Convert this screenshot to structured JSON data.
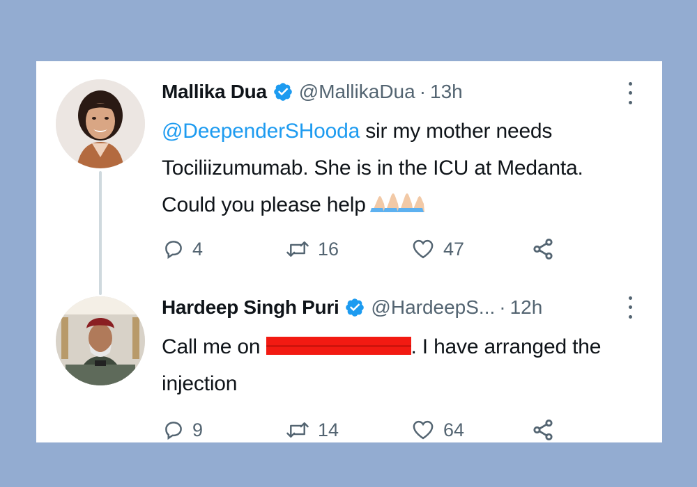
{
  "tweets": [
    {
      "name": "Mallika Dua",
      "handle": "@MallikaDua",
      "separator": "·",
      "time": "13h",
      "mention": "@DeependerSHooda",
      "line1_rest": " sir my mother needs",
      "line2": "Tociliizumumab. She is in the ICU at Medanta.",
      "line3": "Could you please help",
      "emoji": "folded-hands-emoji",
      "replies": "4",
      "retweets": "16",
      "likes": "47"
    },
    {
      "name": "Hardeep Singh Puri",
      "handle": "@HardeepS...",
      "separator": "·",
      "time": "12h",
      "text_before": "Call me on ",
      "text_after": ". I have arranged the",
      "line2": "injection",
      "replies": "9",
      "retweets": "14",
      "likes": "64"
    }
  ],
  "colors": {
    "background": "#93acd1",
    "card": "#ffffff",
    "text": "#0f1419",
    "muted": "#536471",
    "accent": "#1d9bf0",
    "redaction": "#f21a12"
  },
  "icons": [
    "verified-badge-icon",
    "more-options-icon",
    "reply-icon",
    "retweet-icon",
    "like-icon",
    "share-icon"
  ]
}
